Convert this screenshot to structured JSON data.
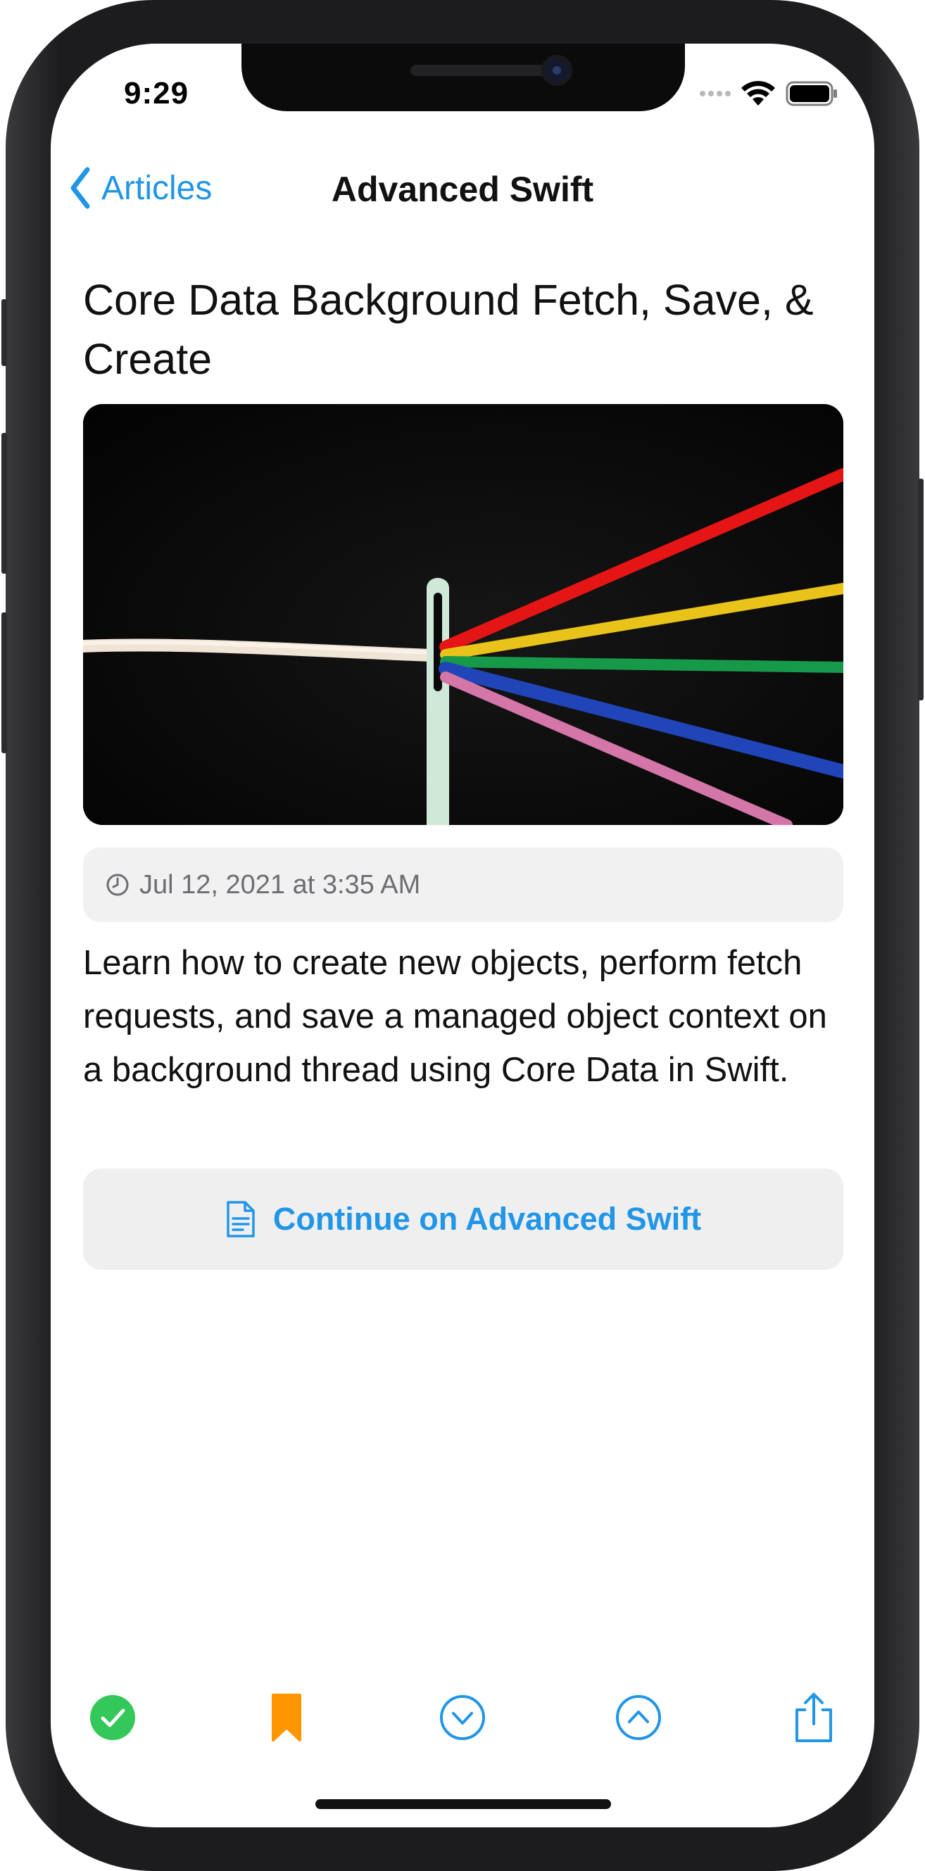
{
  "status_bar": {
    "time": "9:29",
    "icons": [
      "signal-dots-icon",
      "wifi-icon",
      "battery-icon"
    ]
  },
  "nav": {
    "back_label": "Articles",
    "back_icon": "chevron-left-icon",
    "title": "Advanced Swift"
  },
  "article": {
    "title": "Core Data Background Fetch, Save, & Create",
    "hero_image": "needle-with-colored-threads",
    "date": "Jul 12, 2021 at 3:35 AM",
    "date_icon": "clock-icon",
    "summary": "Learn how to create new objects, perform fetch requests, and save a managed object context on a background thread using Core Data in Swift.",
    "continue_label": "Continue on Advanced Swift",
    "continue_icon": "document-icon"
  },
  "toolbar": {
    "items": [
      {
        "name": "mark-read",
        "icon": "checkmark-circle-icon",
        "color": "#34c759"
      },
      {
        "name": "bookmark",
        "icon": "bookmark-icon",
        "color": "#ff9500"
      },
      {
        "name": "next-article",
        "icon": "chevron-down-circle-icon",
        "color": "#2196e6"
      },
      {
        "name": "previous-article",
        "icon": "chevron-up-circle-icon",
        "color": "#2196e6"
      },
      {
        "name": "share",
        "icon": "share-icon",
        "color": "#2196e6"
      }
    ]
  },
  "colors": {
    "accent": "#2196e6",
    "text": "#111111",
    "secondary_text": "#6d6d72",
    "pill_background": "#f1f1f2"
  }
}
